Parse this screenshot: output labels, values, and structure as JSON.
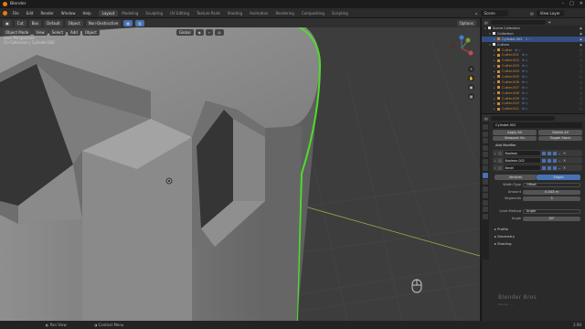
{
  "window": {
    "title": "Blender"
  },
  "menu": [
    "File",
    "Edit",
    "Render",
    "Window",
    "Help"
  ],
  "workspaces": [
    "Layout",
    "Modeling",
    "Sculpting",
    "UV Editing",
    "Texture Paint",
    "Shading",
    "Animation",
    "Rendering",
    "Compositing",
    "Scripting"
  ],
  "active_workspace": "Layout",
  "scene": {
    "label": "Scene",
    "view_layer": "View Layer"
  },
  "viewport_header": {
    "tool": "Cut",
    "mode_extra": "Box",
    "pivot": "Default",
    "object_mode": "Object Mode",
    "view": "View",
    "select": "Select",
    "add": "Add",
    "object": "Object",
    "orientation": "Global",
    "snap": "Non-Destructive",
    "options": "Options"
  },
  "viewport_info": {
    "view_name": "User Perspective",
    "collection_line": "(1) Collection | Cylinder.002"
  },
  "outliner": {
    "rows": [
      {
        "label": "Scene Collection",
        "indent": 0,
        "kind": "scene"
      },
      {
        "label": "Collection",
        "indent": 1,
        "kind": "collection"
      },
      {
        "label": "Cylinder.002",
        "indent": 2,
        "kind": "object",
        "selected": true
      },
      {
        "label": "Cutters",
        "indent": 1,
        "kind": "collection"
      },
      {
        "label": "Cutter",
        "indent": 2,
        "kind": "cutter"
      },
      {
        "label": "Cutter.001",
        "indent": 2,
        "kind": "cutter"
      },
      {
        "label": "Cutter.002",
        "indent": 2,
        "kind": "cutter"
      },
      {
        "label": "Cutter.003",
        "indent": 2,
        "kind": "cutter"
      },
      {
        "label": "Cutter.004",
        "indent": 2,
        "kind": "cutter"
      },
      {
        "label": "Cutter.005",
        "indent": 2,
        "kind": "cutter"
      },
      {
        "label": "Cutter.006",
        "indent": 2,
        "kind": "cutter"
      },
      {
        "label": "Cutter.007",
        "indent": 2,
        "kind": "cutter"
      },
      {
        "label": "Cutter.008",
        "indent": 2,
        "kind": "cutter"
      },
      {
        "label": "Cutter.009",
        "indent": 2,
        "kind": "cutter"
      },
      {
        "label": "Cutter.010",
        "indent": 2,
        "kind": "cutter"
      },
      {
        "label": "Cutter.011",
        "indent": 2,
        "kind": "cutter"
      }
    ]
  },
  "properties": {
    "object_name": "Cylinder.002",
    "apply_all": "Apply All",
    "delete_all": "Delete All",
    "viewport_vis": "Viewport Vis",
    "toggle_stack": "Toggle Stack",
    "add_modifier": "Add Modifier",
    "modifiers": [
      "Boolean",
      "Boolean.002",
      "Bevel"
    ],
    "vertices_tab": "Vertices",
    "edges_tab": "Edges",
    "width_type_label": "Width Type",
    "width_type_value": "Offset",
    "amount_label": "Amount",
    "amount_value": "0.043 m",
    "segments_label": "Segments",
    "segments_value": "3",
    "limit_method_label": "Limit Method",
    "limit_method_value": "Angle",
    "angle_label": "Angle",
    "angle_value": "30°",
    "sections": [
      "Profile",
      "Geometry",
      "Shading"
    ]
  },
  "status": {
    "pan_view": "Pan View",
    "context_menu": "Context Menu",
    "version": "2.90"
  },
  "watermark": {
    "brand": "Blender Bros",
    "tagline": "Blender. ....."
  },
  "colors": {
    "accent": "#4772b3",
    "selection_outline": "#4fdc2a",
    "cutter_orange": "#d38c3a"
  }
}
